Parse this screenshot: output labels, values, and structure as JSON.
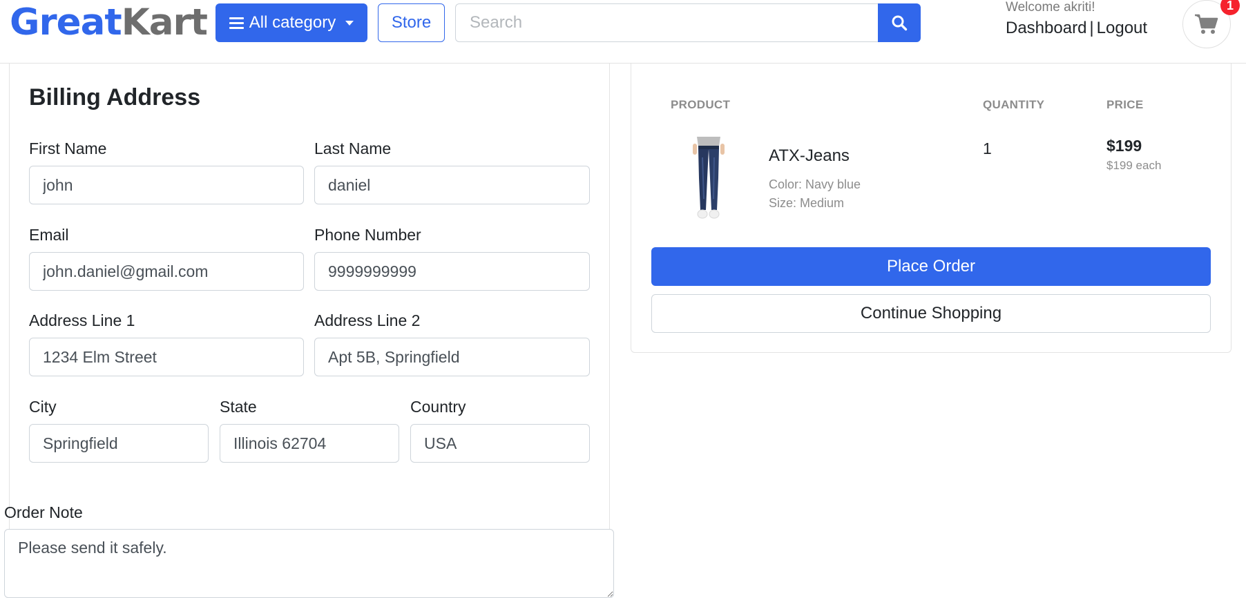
{
  "header": {
    "brand_part1": "Great",
    "brand_part2": "Kart",
    "category_button": "All category",
    "store_button": "Store",
    "search_placeholder": "Search",
    "welcome_text": "Welcome akriti!",
    "dashboard_link": "Dashboard",
    "separator": "|",
    "logout_link": "Logout",
    "cart_count": "1"
  },
  "billing": {
    "title": "Billing Address",
    "fields": {
      "first_name": {
        "label": "First Name",
        "value": "john"
      },
      "last_name": {
        "label": "Last Name",
        "value": "daniel"
      },
      "email": {
        "label": "Email",
        "value": "john.daniel@gmail.com"
      },
      "phone": {
        "label": "Phone Number",
        "value": "9999999999"
      },
      "address1": {
        "label": "Address Line 1",
        "value": "1234 Elm Street"
      },
      "address2": {
        "label": "Address Line 2",
        "value": "Apt 5B, Springfield"
      },
      "city": {
        "label": "City",
        "value": "Springfield"
      },
      "state": {
        "label": "State",
        "value": "Illinois 62704"
      },
      "country": {
        "label": "Country",
        "value": "USA"
      }
    },
    "order_note": {
      "label": "Order Note",
      "value": "Please send it safely."
    }
  },
  "summary": {
    "columns": {
      "product": "PRODUCT",
      "quantity": "QUANTITY",
      "price": "PRICE"
    },
    "items": [
      {
        "name": "ATX-Jeans",
        "color": "Color: Navy blue",
        "size": "Size: Medium",
        "quantity": "1",
        "price": "$199",
        "price_each": "$199 each"
      }
    ],
    "place_order": "Place Order",
    "continue_shopping": "Continue Shopping"
  },
  "colors": {
    "primary": "#3167eb",
    "badge": "#f5222d",
    "muted": "#8c8c8c"
  }
}
